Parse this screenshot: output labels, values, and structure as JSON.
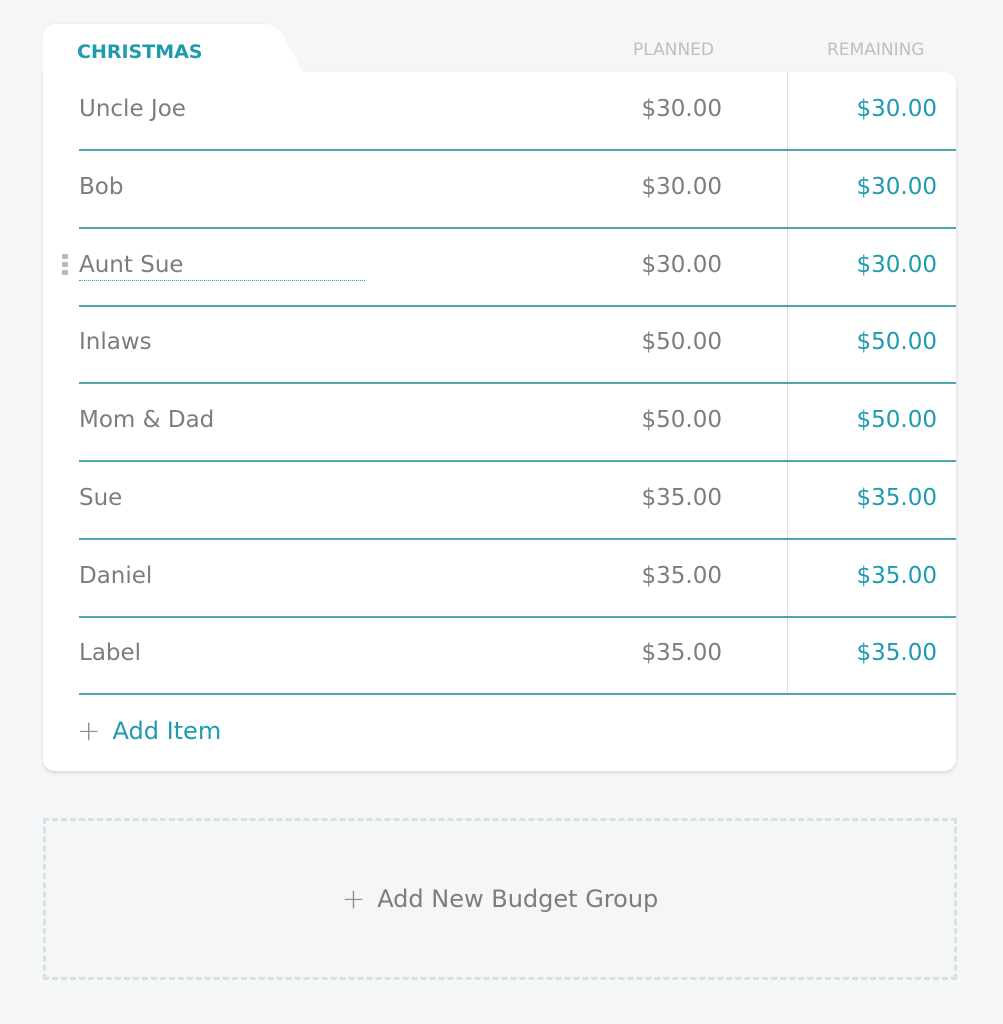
{
  "group": {
    "title": "CHRISTMAS",
    "columns": {
      "planned": "PLANNED",
      "remaining": "REMAINING"
    },
    "items": [
      {
        "name": "Uncle Joe",
        "planned": "$30.00",
        "remaining": "$30.00"
      },
      {
        "name": "Bob",
        "planned": "$30.00",
        "remaining": "$30.00"
      },
      {
        "name": "Aunt Sue",
        "planned": "$30.00",
        "remaining": "$30.00",
        "editing": true
      },
      {
        "name": "Inlaws",
        "planned": "$50.00",
        "remaining": "$50.00"
      },
      {
        "name": "Mom & Dad",
        "planned": "$50.00",
        "remaining": "$50.00"
      },
      {
        "name": "Sue",
        "planned": "$35.00",
        "remaining": "$35.00"
      },
      {
        "name": "Daniel",
        "planned": "$35.00",
        "remaining": "$35.00"
      },
      {
        "name": "Label",
        "planned": "$35.00",
        "remaining": "$35.00"
      }
    ],
    "add_item_label": "Add Item"
  },
  "add_group_label": "Add New Budget Group",
  "colors": {
    "accent": "#1f9bb0",
    "text": "#7b7d7f",
    "divider": "#4fa6ae",
    "background": "#f5f6f7"
  },
  "icons": {
    "add": "plus-icon",
    "drag": "drag-handle-icon"
  }
}
